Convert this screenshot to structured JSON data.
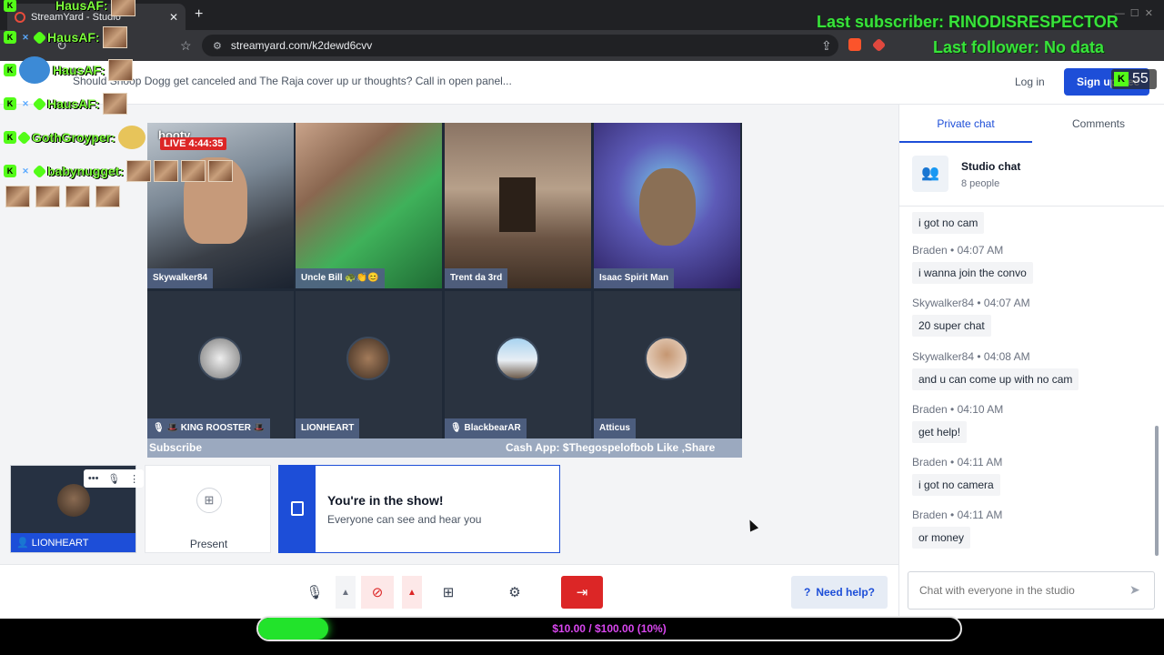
{
  "browser": {
    "tab_title": "StreamYard - Studio",
    "url": "streamyard.com/k2dewd6cvv"
  },
  "header": {
    "title": "Should Snoop Dogg get canceled and The Raja cover up ur thoughts? Call in open panel...",
    "login": "Log in",
    "signup": "Sign up free"
  },
  "stage": {
    "live_time": "LIVE 4:44:35",
    "booty_label": "booty",
    "cam_tiles": [
      {
        "name": "Skywalker84"
      },
      {
        "name": "Uncle Bill 🐢👏😊"
      },
      {
        "name": "Trent da 3rd"
      },
      {
        "name": "Isaac Spirit Man"
      }
    ],
    "avatar_tiles": [
      {
        "name": "🎙 🎩 KING ROOSTER 🎩"
      },
      {
        "name": "LIONHEART"
      },
      {
        "name": "🎙 BlackbearAR"
      },
      {
        "name": "Atticus"
      }
    ],
    "banner_left": "Subscribe",
    "banner_right": "Cash App: $Thegospelofbob Like ,Share"
  },
  "backstage": {
    "self_name": "LIONHEART",
    "present_label": "Present",
    "show_title": "You're in the show!",
    "show_sub": "Everyone can see and hear you"
  },
  "toolbar": {
    "help": "Need help?"
  },
  "chat": {
    "tabs": [
      "Private chat",
      "Comments"
    ],
    "studio_name": "Studio chat",
    "studio_count": "8 people",
    "messages": [
      {
        "author": "",
        "time": "",
        "text": "i got no cam"
      },
      {
        "author": "Braden",
        "time": "04:07 AM",
        "text": "i wanna join the convo"
      },
      {
        "author": "Skywalker84",
        "time": "04:07 AM",
        "text": "20 super chat"
      },
      {
        "author": "Skywalker84",
        "time": "04:08 AM",
        "text": "and u can come up with no cam"
      },
      {
        "author": "Braden",
        "time": "04:10 AM",
        "text": "get help!"
      },
      {
        "author": "Braden",
        "time": "04:11 AM",
        "text": "i got no camera"
      },
      {
        "author": "Braden",
        "time": "04:11 AM",
        "text": "or money"
      }
    ],
    "input_placeholder": "Chat with everyone in the studio"
  },
  "overlay": {
    "users": [
      "HausAF:",
      "HausAF:",
      "HausAF:",
      "HausAF:",
      "GothGroyper:",
      "babynugget:"
    ],
    "last_subscriber": "Last subscriber: RINODISRESPECTOR",
    "last_follower": "Last follower: No data",
    "kick_count": "55",
    "goal_text": "$10.00 / $100.00 (10%)",
    "goal_fraction": 0.1
  }
}
